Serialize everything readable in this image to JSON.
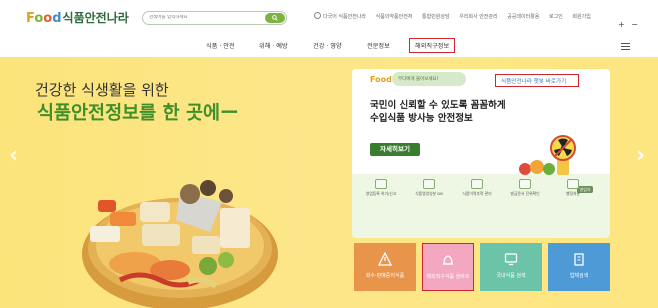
{
  "header": {
    "logo_food": [
      "F",
      "o",
      "o",
      "d"
    ],
    "logo_text": "식품안전나라",
    "search_placeholder": "검색어를 입력하세요",
    "util_links": [
      "다국어 식품안전나라",
      "식품의약품안전처",
      "통합민원상담",
      "우리회사 안전관리",
      "공공데이터활용",
      "로그인",
      "회원가입"
    ],
    "zoom_in": "+",
    "zoom_out": "−"
  },
  "gnb": {
    "items": [
      "식품 · 안전",
      "위해 · 예방",
      "건강 · 영양",
      "전문정보",
      "해외직구정보"
    ]
  },
  "hero": {
    "subtitle": "건강한 식생활을 위한",
    "title": "식품안전정보를 한 곳에ー",
    "prev_arrow": "‹",
    "next_arrow": "›"
  },
  "card": {
    "logo": "Food",
    "pill_text": "무다에게 물어보세요!",
    "chatbot_label": "식품안전나라 챗봇 바로가기",
    "headline_line1": "국민이 신뢰할 수 있도록 꼼꼼하게",
    "headline_line2": "수입식품 방사능 안전정보",
    "detail_button": "자세히보기",
    "more_label": "영업자",
    "quick_items": [
      "영업등록 허가/신고",
      "식품영양성분 DB",
      "식품이력추적 관리",
      "발급문서 진위확인",
      "행정처분"
    ]
  },
  "tiles": [
    {
      "label": "회수·판매중지식품",
      "color": "#e8944a",
      "icon": "warning-icon"
    },
    {
      "label": "해외직구식품 올바로",
      "color": "#f3a7c0",
      "icon": "bell-icon"
    },
    {
      "label": "국내식품 검색",
      "color": "#6cc4a8",
      "icon": "monitor-icon"
    },
    {
      "label": "업체검색",
      "color": "#4d9ad6",
      "icon": "building-icon"
    }
  ],
  "colors": {
    "brand_green": "#3f8f2a",
    "highlight_red": "#d0262d",
    "hero_yellow": "#fde689"
  }
}
